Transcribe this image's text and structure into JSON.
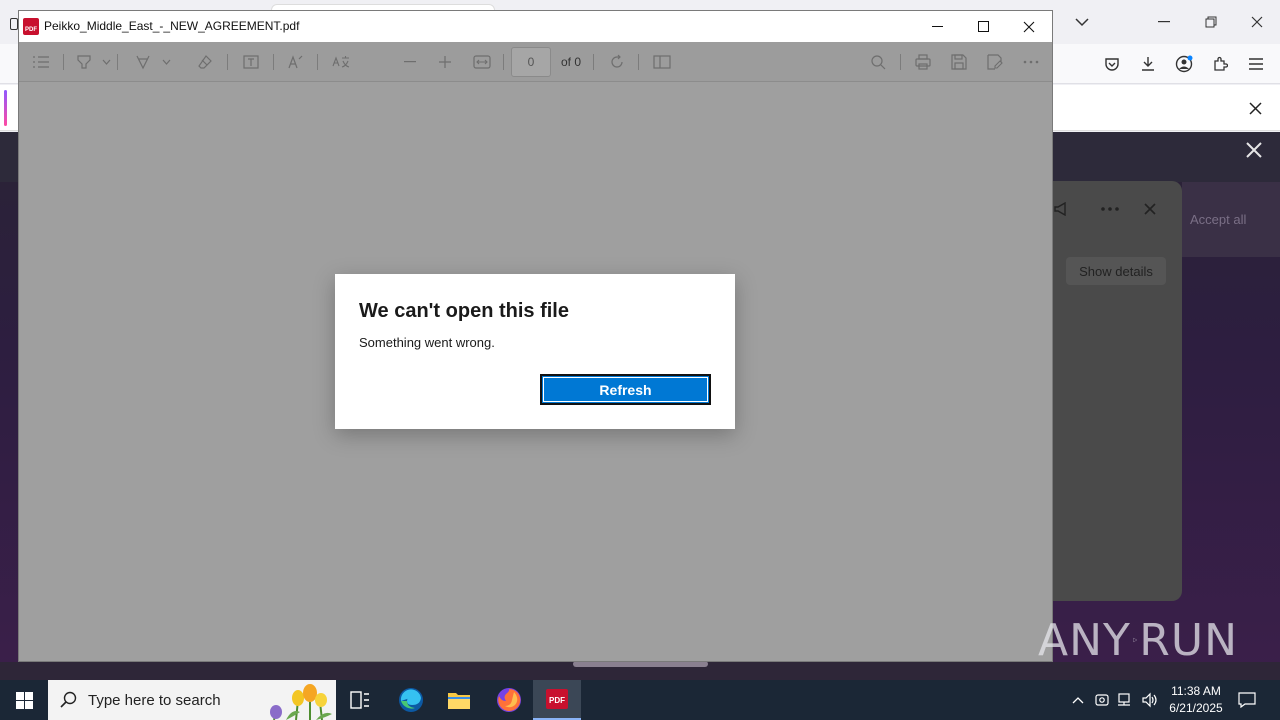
{
  "pdf_window": {
    "title": "Peikko_Middle_East_-_NEW_AGREEMENT.pdf",
    "app_icon_label": "PDF",
    "toolbar": {
      "page_value": "0",
      "page_of": "of 0"
    }
  },
  "dialog": {
    "title": "We can't open this file",
    "message": "Something went wrong.",
    "refresh_label": "Refresh"
  },
  "background_browser": {
    "show_details_label": "Show details",
    "accept_label": "Accept all"
  },
  "watermark": {
    "left": "ANY",
    "right": "RUN"
  },
  "taskbar": {
    "search_placeholder": "Type here to search",
    "time": "11:38 AM",
    "date": "6/21/2025",
    "active_app": "pdf-reader"
  },
  "colors": {
    "dialog_button": "#0078d4",
    "taskbar": "#1b2736",
    "dim_overlay": "#9f9f9f"
  }
}
